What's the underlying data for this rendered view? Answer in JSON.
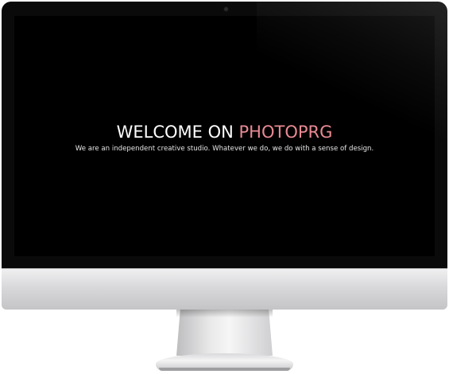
{
  "page": {
    "hero": {
      "title_prefix": "WELCOME ON ",
      "title_brand": "PHOTOPRG",
      "subtitle": "We are an independent creative studio. Whatever we do, we do with a sense of design."
    }
  },
  "colors": {
    "brand_accent": "#e98a93",
    "screen_background": "#000000",
    "title_text": "#ffffff"
  },
  "icons": {
    "camera": "webcam-icon"
  }
}
